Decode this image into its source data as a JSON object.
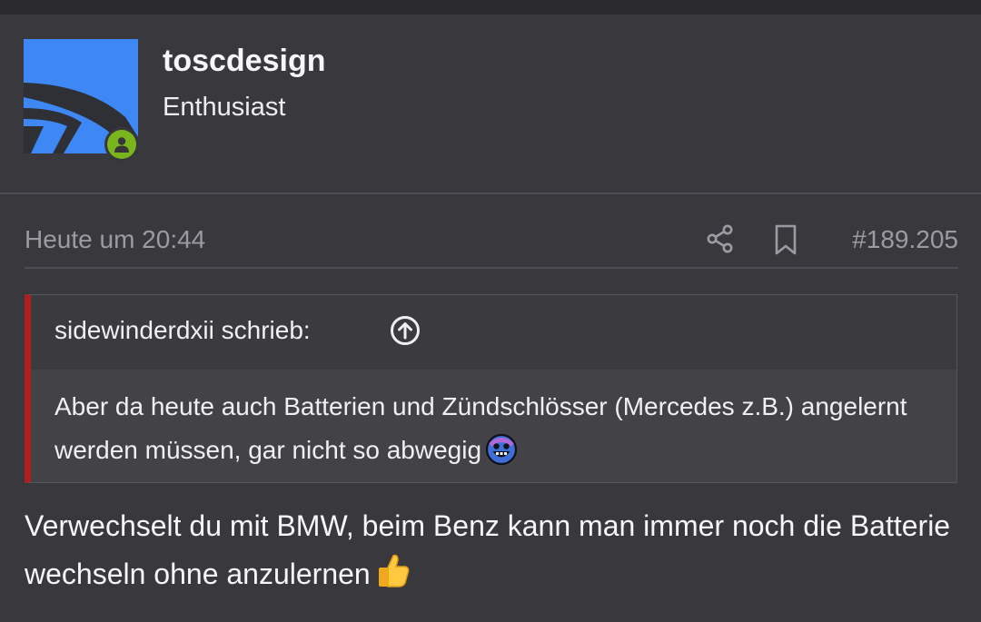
{
  "author": {
    "username": "toscdesign",
    "user_title": "Enthusiast",
    "avatar_icon": "brand-logo-avatar",
    "status_icon": "online-user-icon",
    "status_color": "#7ab51d"
  },
  "meta": {
    "time": "Heute um 20:44",
    "share_icon": "share-icon",
    "bookmark_icon": "bookmark-icon",
    "post_number": "#189.205"
  },
  "quote": {
    "author_line": "sidewinderdxii schrieb:",
    "jump_icon": "arrow-up-circle-icon",
    "text": "Aber da heute auch Batterien und Zündschlösser (Mercedes z.B.) angelernt werden müssen, gar nicht so abwegig",
    "emoji": "grinning-face-emoji",
    "accent_color": "#b01e1e"
  },
  "post": {
    "text": "Verwechselt du mit BMW, beim Benz kann man immer noch die Batterie wechseln ohne anzulernen",
    "emoji": "thumbs-up-emoji"
  },
  "colors": {
    "background": "#38383d",
    "muted_text": "#9b9ba1",
    "avatar_blue": "#3d88f4"
  }
}
